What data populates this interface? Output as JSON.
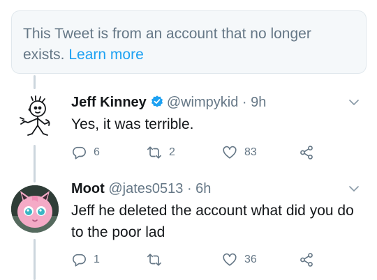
{
  "notice": {
    "text": "This Tweet is from an account that no longer exists.",
    "link": "Learn more"
  },
  "tweets": [
    {
      "name": "Jeff Kinney",
      "verified": true,
      "handle": "@wimpykid",
      "separator": "·",
      "time": "9h",
      "text": "Yes, it was terrible.",
      "avatar": "wimpy-kid-doodle-avatar",
      "replies": "6",
      "retweets": "2",
      "likes": "83"
    },
    {
      "name": "Moot",
      "verified": false,
      "handle": "@jates0513",
      "separator": "·",
      "time": "6h",
      "text": "Jeff he deleted the account what did you do to the poor lad",
      "avatar": "jigglypuff-avatar",
      "replies": "1",
      "retweets": "",
      "likes": "36"
    }
  ],
  "colors": {
    "accent": "#1da1f2",
    "muted": "#657786",
    "notice_bg": "#f5f8fa",
    "thread_line": "#ccd6dd"
  },
  "icons": [
    "reply-icon",
    "retweet-icon",
    "like-icon",
    "share-icon",
    "chevron-down-icon",
    "verified-icon"
  ]
}
